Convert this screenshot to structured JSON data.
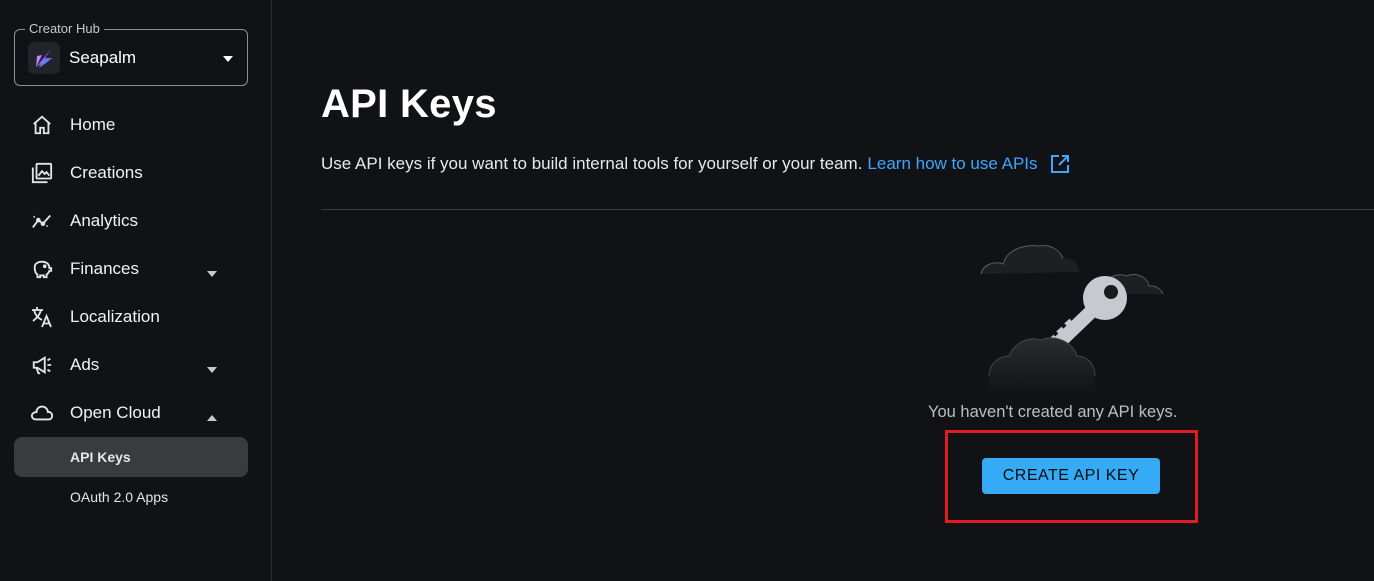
{
  "hub": {
    "legend": "Creator Hub",
    "selected": "Seapalm"
  },
  "nav": {
    "items": [
      {
        "label": "Home",
        "icon": "home-icon"
      },
      {
        "label": "Creations",
        "icon": "image-stack-icon"
      },
      {
        "label": "Analytics",
        "icon": "analytics-icon"
      },
      {
        "label": "Finances",
        "icon": "piggy-bank-icon",
        "caret": "down"
      },
      {
        "label": "Localization",
        "icon": "translate-icon"
      },
      {
        "label": "Ads",
        "icon": "megaphone-icon",
        "caret": "down"
      },
      {
        "label": "Open Cloud",
        "icon": "cloud-icon",
        "caret": "up"
      }
    ],
    "sub_items": [
      {
        "label": "API Keys",
        "active": true
      },
      {
        "label": "OAuth 2.0 Apps",
        "active": false
      }
    ]
  },
  "page": {
    "title": "API Keys",
    "description": "Use API keys if you want to build internal tools for yourself or your team.",
    "learn_link": "Learn how to use APIs",
    "empty_message": "You haven't created any API keys.",
    "create_button": "CREATE API KEY"
  },
  "colors": {
    "background": "#111216",
    "link": "#3ea6ff",
    "button": "#35aaf5",
    "active_item": "#393b3d",
    "highlight": "#e31c23"
  }
}
